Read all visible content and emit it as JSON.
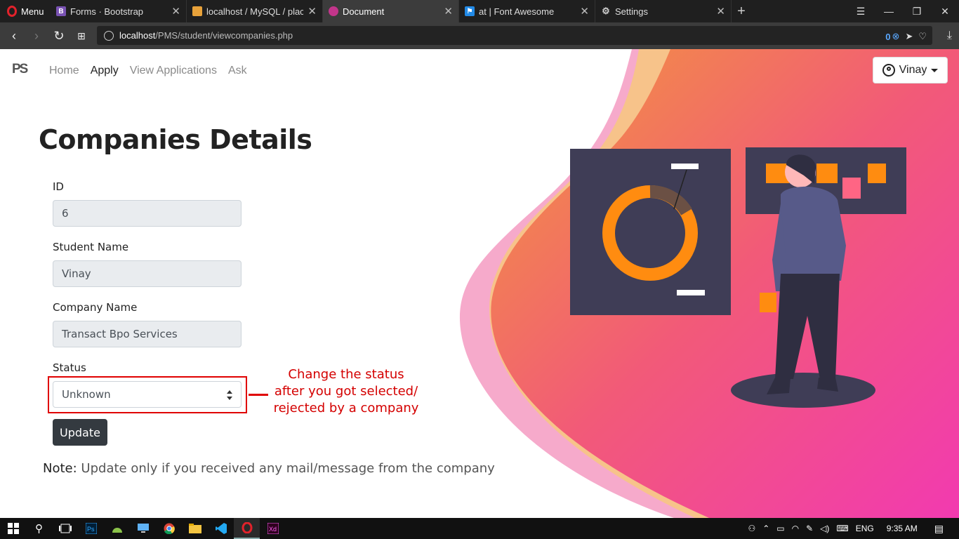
{
  "browser": {
    "menu_label": "Menu",
    "tabs": [
      {
        "title": "Forms · Bootstrap",
        "icon": "bootstrap-icon",
        "active": false
      },
      {
        "title": "localhost / MySQL / placem",
        "icon": "phpmyadmin-icon",
        "active": false
      },
      {
        "title": "Document",
        "icon": "document-icon",
        "active": true
      },
      {
        "title": "at | Font Awesome",
        "icon": "fontawesome-icon",
        "active": false
      },
      {
        "title": "Settings",
        "icon": "gear-icon",
        "active": false
      }
    ],
    "url_host": "localhost",
    "url_path": "/PMS/student/viewcompanies.php",
    "adblock_count": "0"
  },
  "nav": {
    "brand": "PS",
    "items": [
      "Home",
      "Apply",
      "View Applications",
      "Ask"
    ],
    "active": "Apply",
    "user": "Vinay"
  },
  "form": {
    "title": "Companies Details",
    "id_label": "ID",
    "id_value": "6",
    "student_label": "Student Name",
    "student_value": "Vinay",
    "company_label": "Company Name",
    "company_value": "Transact Bpo Services",
    "status_label": "Status",
    "status_value": "Unknown",
    "update_label": "Update",
    "note_label": "Note:",
    "note_text": "Update only if you received any mail/message from the company"
  },
  "annotation": {
    "line1": "Change the status",
    "line2": "after you got selected/",
    "line3": "rejected by a company"
  },
  "taskbar": {
    "lang": "ENG",
    "time": "9:35 AM"
  },
  "colors": {
    "accent_red": "#e00000",
    "button_dark": "#343a40",
    "hero_pink": "#f5439e",
    "hero_orange": "#f08a2a"
  }
}
